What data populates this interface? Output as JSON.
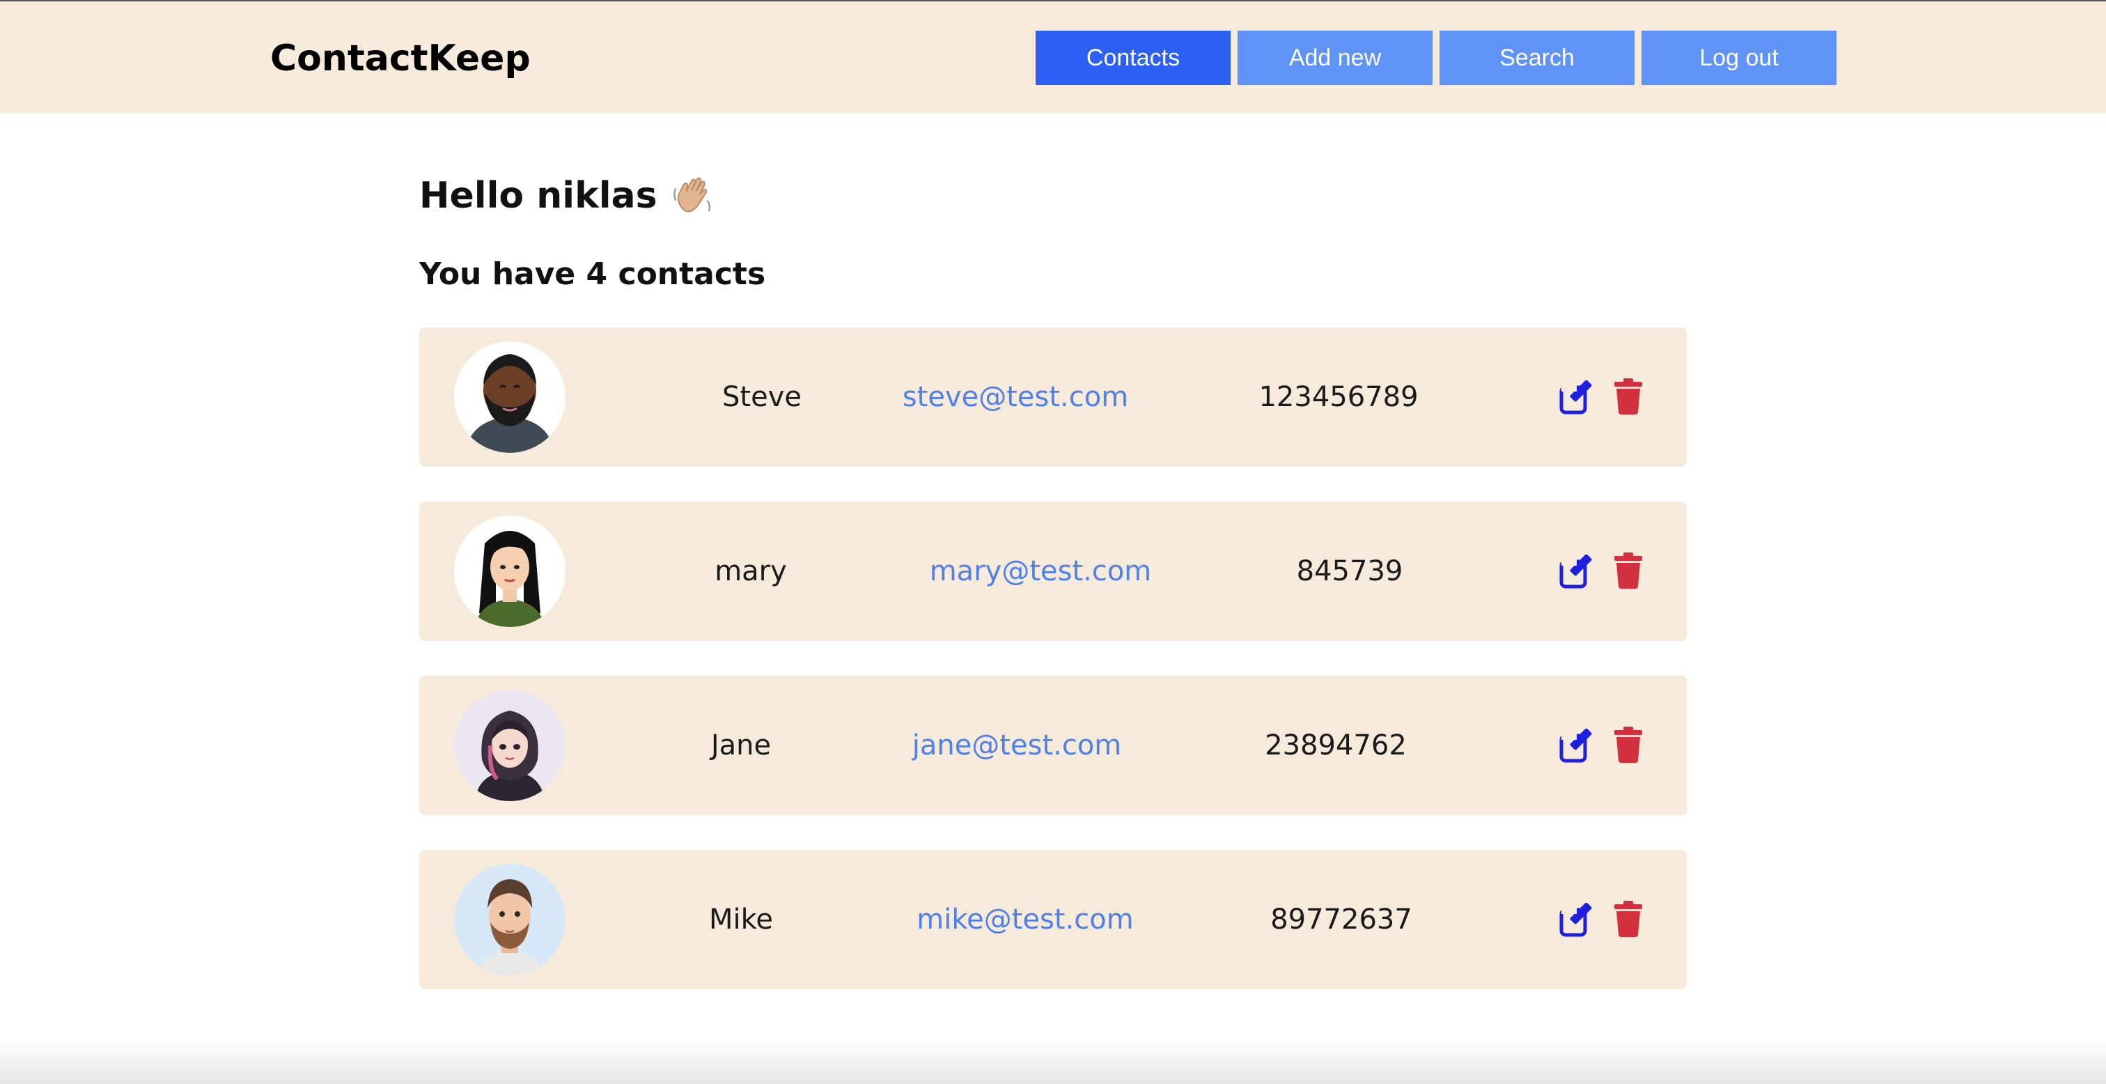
{
  "app": {
    "logo": "ContactKeep"
  },
  "nav": {
    "items": [
      {
        "label": "Contacts",
        "active": true
      },
      {
        "label": "Add new",
        "active": false
      },
      {
        "label": "Search",
        "active": false
      },
      {
        "label": "Log out",
        "active": false
      }
    ]
  },
  "main": {
    "greeting": "Hello niklas",
    "greeting_icon": "waving-hand-icon",
    "count_text": "You have 4 contacts"
  },
  "contacts": [
    {
      "name": "Steve",
      "email": "steve@test.com",
      "phone": "123456789",
      "avatar": "bearded-man-avatar"
    },
    {
      "name": "mary",
      "email": "mary@test.com",
      "phone": "845739",
      "avatar": "long-haired-woman-avatar"
    },
    {
      "name": "Jane",
      "email": "jane@test.com",
      "phone": "23894762",
      "avatar": "hooded-woman-avatar"
    },
    {
      "name": "Mike",
      "email": "mike@test.com",
      "phone": "89772637",
      "avatar": "bearded-man-light-avatar"
    }
  ],
  "icons": {
    "edit": "edit-icon",
    "delete": "trash-icon"
  },
  "colors": {
    "header_bg": "#f6eada",
    "card_bg": "#f6eada",
    "nav_active": "#2b60f3",
    "nav_inactive": "#6093f7",
    "email_link": "#4f80ea",
    "edit_icon": "#1f1fe0",
    "delete_icon": "#d2303f"
  }
}
